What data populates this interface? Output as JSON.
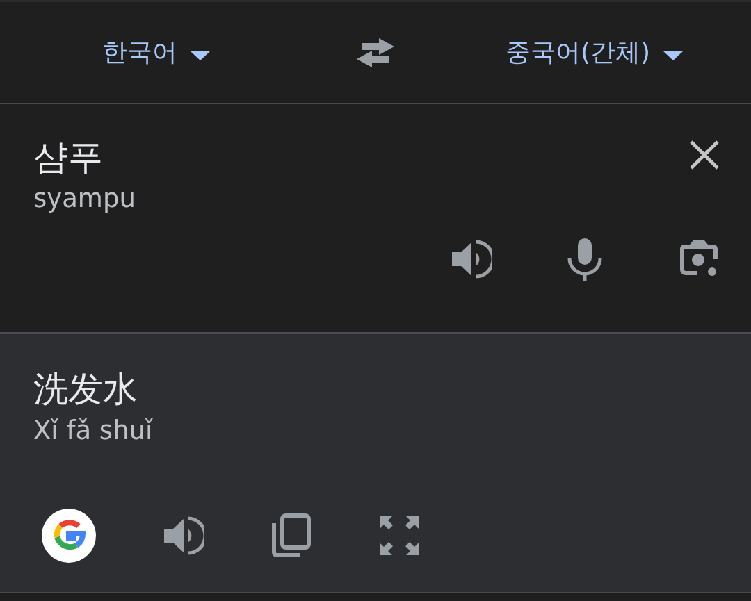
{
  "language_bar": {
    "source_language": "한국어",
    "target_language": "중국어(간체)"
  },
  "source": {
    "text": "샴푸",
    "romanization": "syampu"
  },
  "translation": {
    "text": "洗发水",
    "romanization": "Xǐ fǎ shuǐ"
  }
}
